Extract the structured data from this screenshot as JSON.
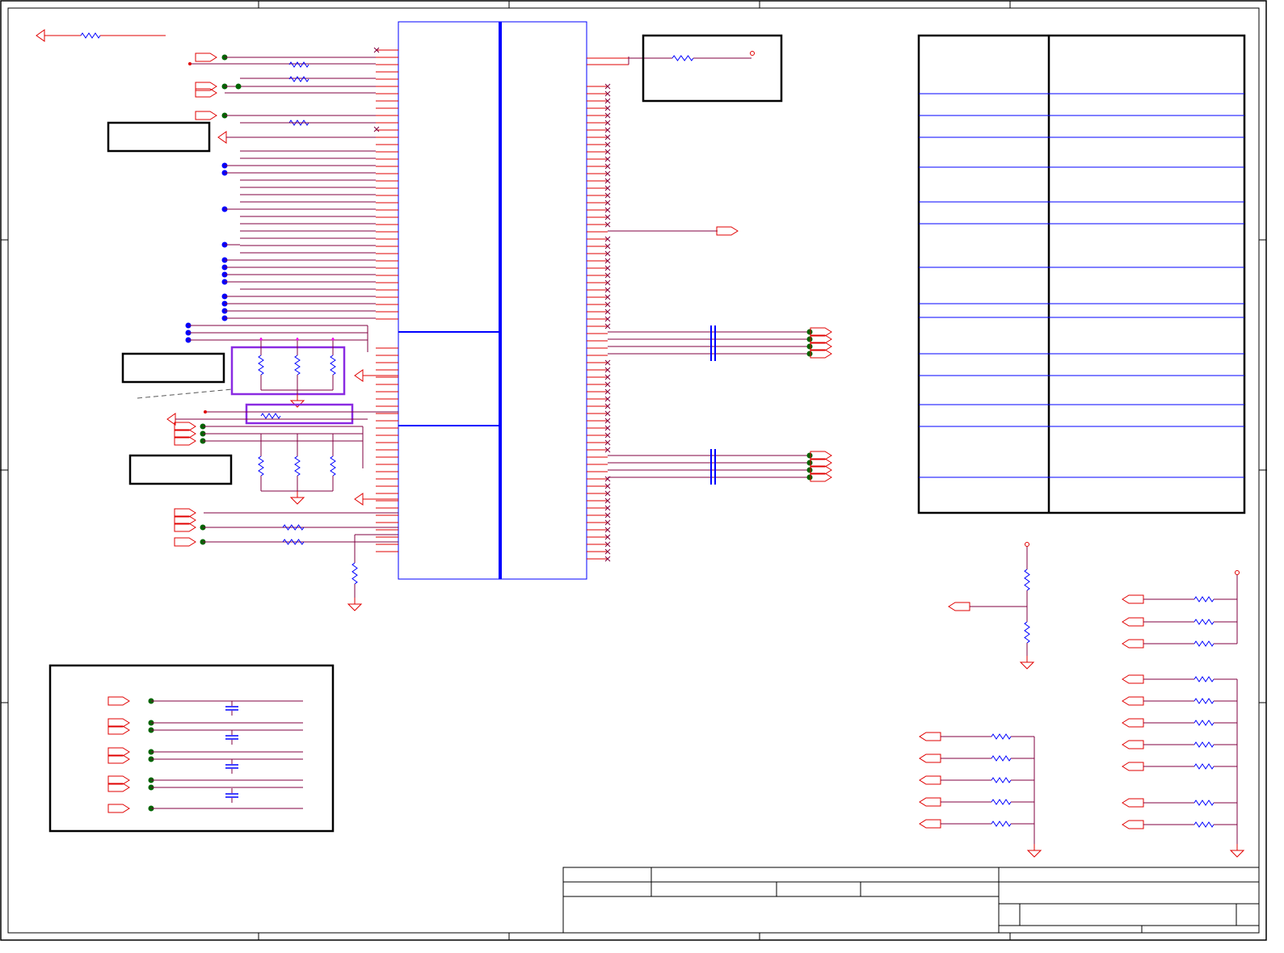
{
  "sheet": {
    "title": "",
    "colors": {
      "frame": "#000000",
      "wire": "#e00000",
      "net": "#800040",
      "component": "#0000ff",
      "junction_blue": "#0000ff",
      "junction_green": "#006400",
      "highlight_box": "#8a2be2",
      "background": "#ffffff"
    }
  },
  "main_ic": {
    "left_pins": 46,
    "right_pins_nc": 80
  },
  "pin_table": {
    "rows": 14
  },
  "title_block": {
    "cells": []
  }
}
